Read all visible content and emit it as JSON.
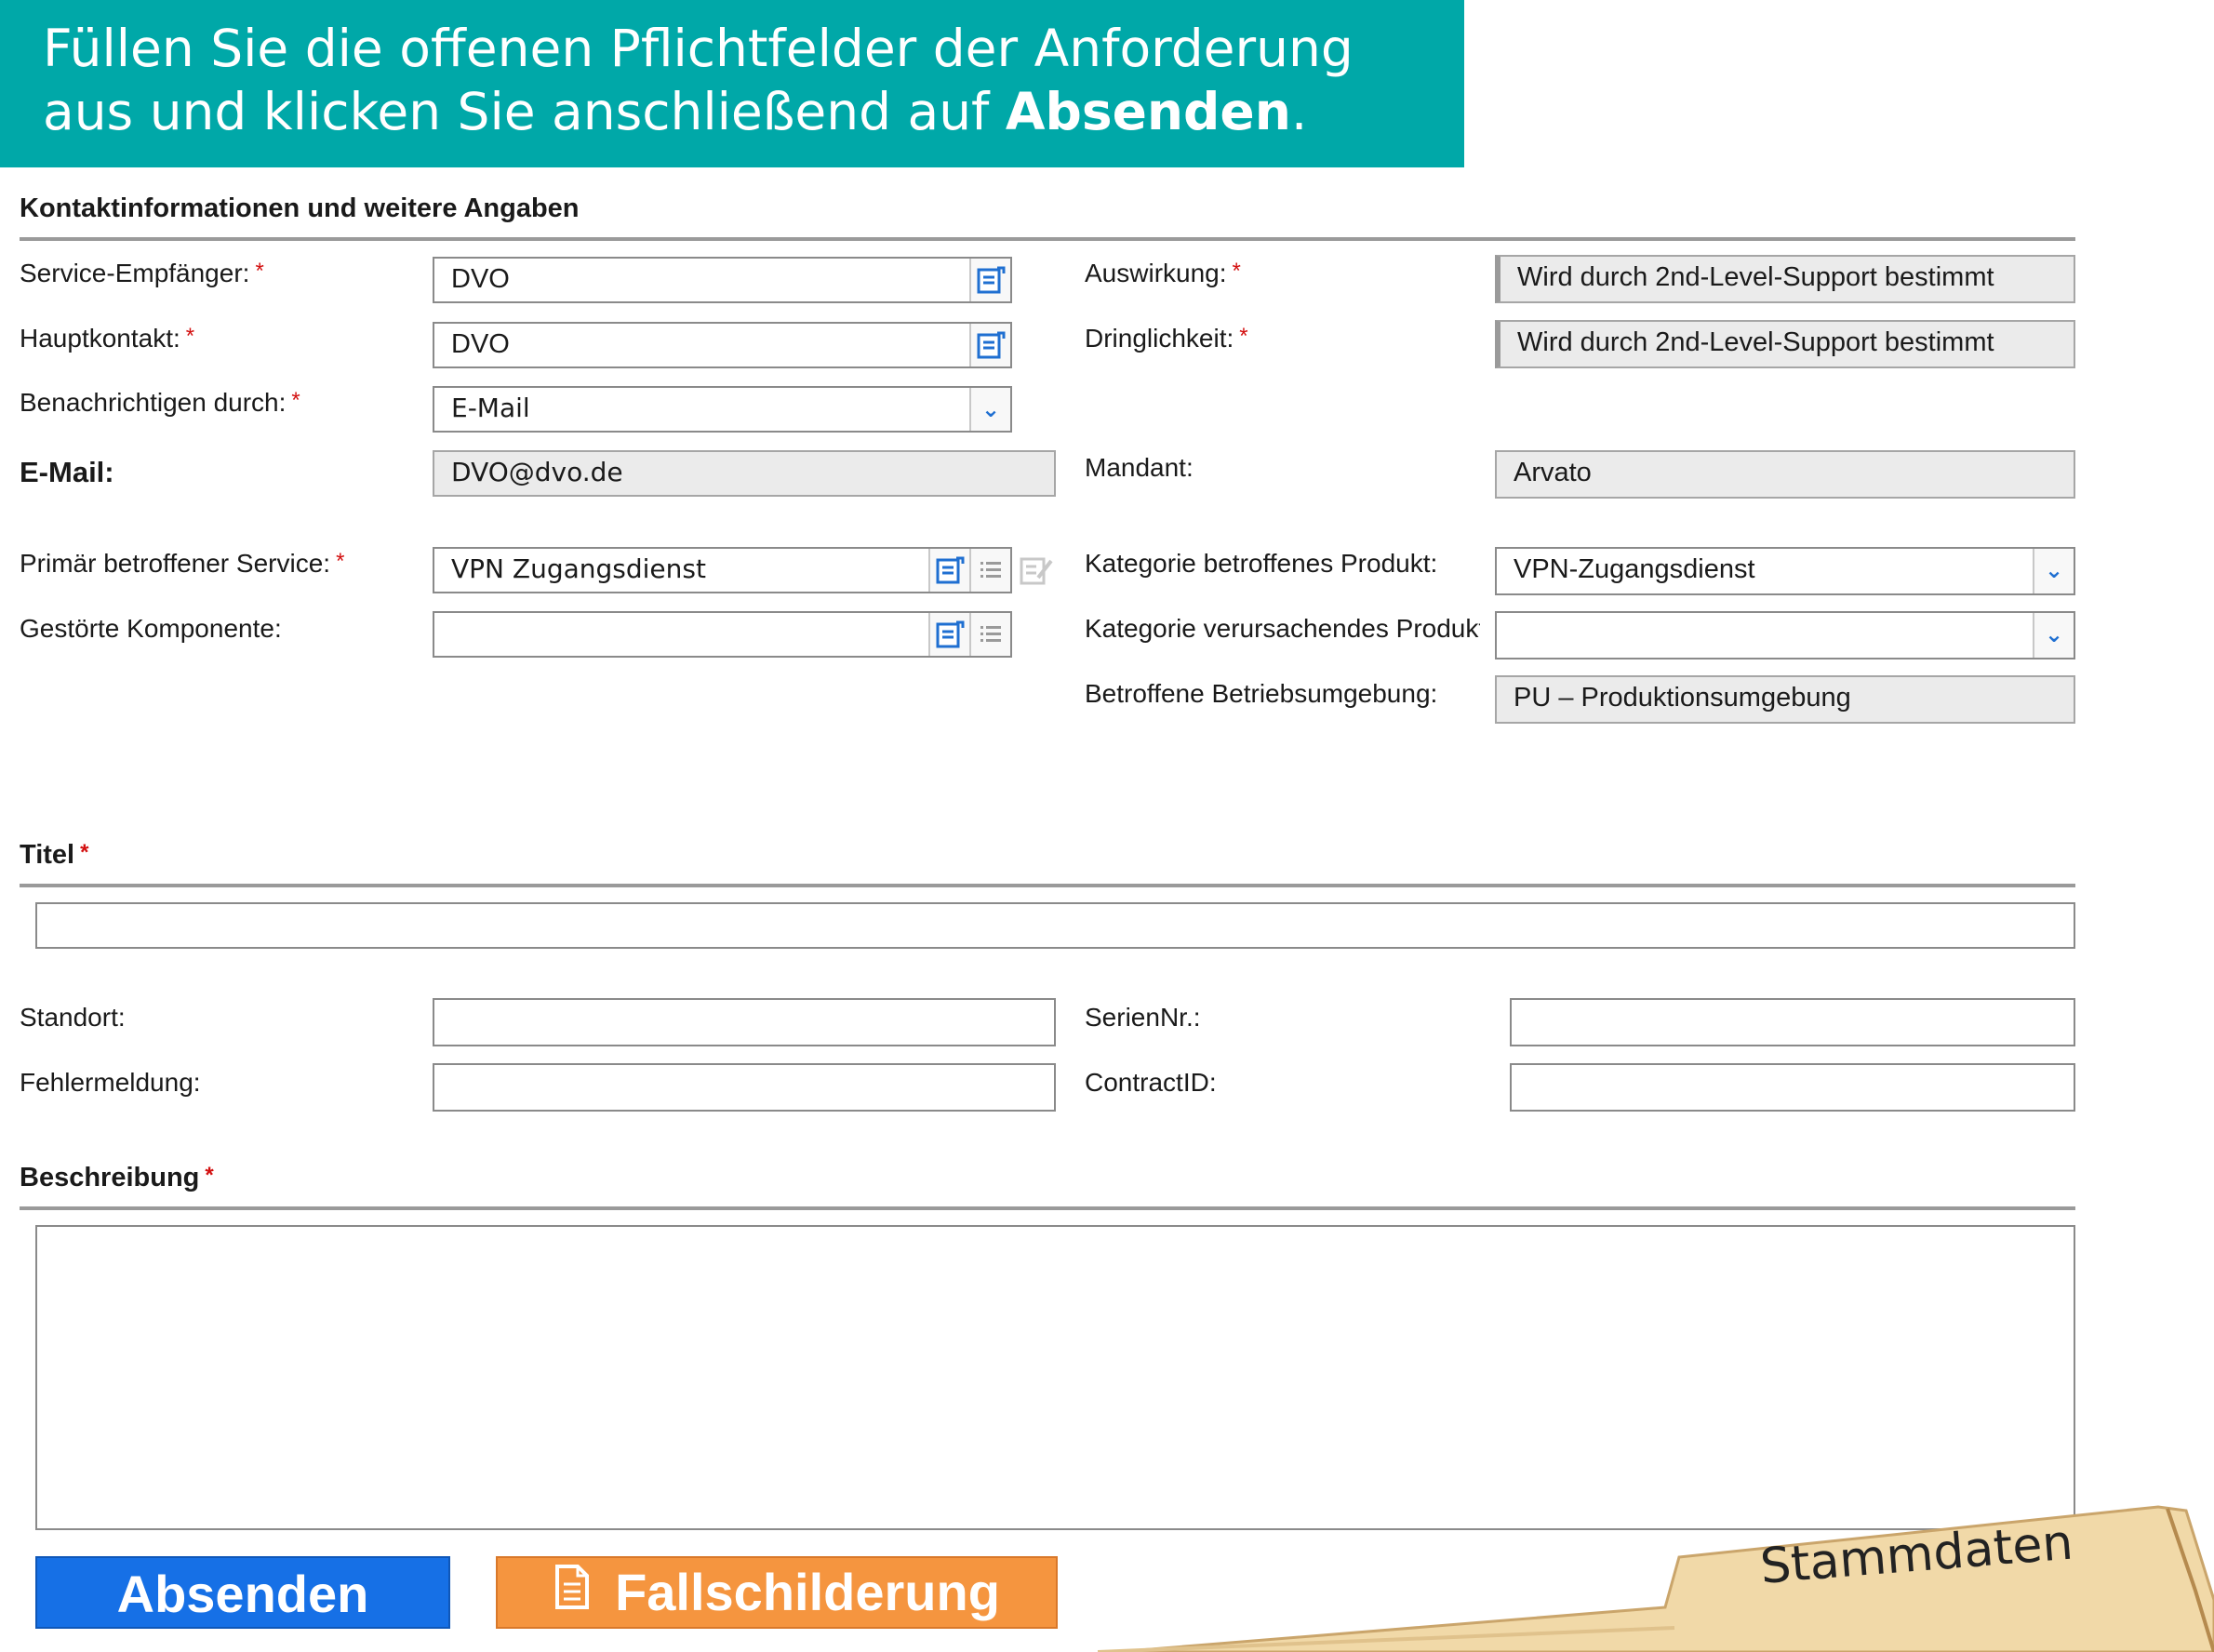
{
  "banner": {
    "line1": "Füllen Sie die offenen Pflichtfelder der Anforderung",
    "line2_prefix": "aus und klicken Sie anschließend auf ",
    "line2_bold": "Absenden",
    "line2_suffix": "."
  },
  "required_marker": "*",
  "contact_section": {
    "title": "Kontaktinformationen und weitere Angaben",
    "service_recipient": {
      "label": "Service-Empfänger:",
      "value": "DVO",
      "required": true
    },
    "main_contact": {
      "label": "Hauptkontakt:",
      "value": "DVO",
      "required": true
    },
    "notify_by": {
      "label": "Benachrichtigen durch:",
      "value": "E-Mail",
      "required": true
    },
    "email": {
      "label": "E-Mail:",
      "value": "DVO@dvo.de"
    },
    "primary_service": {
      "label": "Primär betroffener Service:",
      "value": "VPN Zugangsdienst",
      "required": true
    },
    "faulty_component": {
      "label": "Gestörte Komponente:",
      "value": ""
    },
    "impact": {
      "label": "Auswirkung:",
      "value": "Wird durch 2nd-Level-Support bestimmt",
      "required": true
    },
    "urgency": {
      "label": "Dringlichkeit:",
      "value": "Wird durch 2nd-Level-Support bestimmt",
      "required": true
    },
    "client": {
      "label": "Mandant:",
      "value": "Arvato"
    },
    "affected_product_category": {
      "label": "Kategorie betroffenes Produkt:",
      "value": "VPN-Zugangsdienst"
    },
    "causing_product_category": {
      "label": "Kategorie verursachendes Produkt",
      "value": ""
    },
    "affected_environment": {
      "label": "Betroffene Betriebsumgebung:",
      "value": "PU – Produktionsumgebung"
    }
  },
  "title_section": {
    "title": "Titel",
    "required": true,
    "value": ""
  },
  "details": {
    "location": {
      "label": "Standort:",
      "value": ""
    },
    "error_message": {
      "label": "Fehlermeldung:",
      "value": ""
    },
    "serial_no": {
      "label": "SerienNr.:",
      "value": ""
    },
    "contract_id": {
      "label": "ContractID:",
      "value": ""
    }
  },
  "description_section": {
    "title": "Beschreibung",
    "required": true,
    "value": ""
  },
  "buttons": {
    "submit": "Absenden",
    "case_description": "Fallschilderung"
  },
  "tab": {
    "label": "Stammdaten"
  },
  "icons": {
    "lookup": "lookup-list-icon",
    "list": "list-icon",
    "edit": "edit-form-icon",
    "dropdown": "chevron-down-icon",
    "document": "document-icon"
  },
  "colors": {
    "banner": "#00a8a8",
    "submit": "#1670e6",
    "case_button": "#f5953f",
    "required": "#d31010",
    "tab": "#f1d9a8"
  }
}
